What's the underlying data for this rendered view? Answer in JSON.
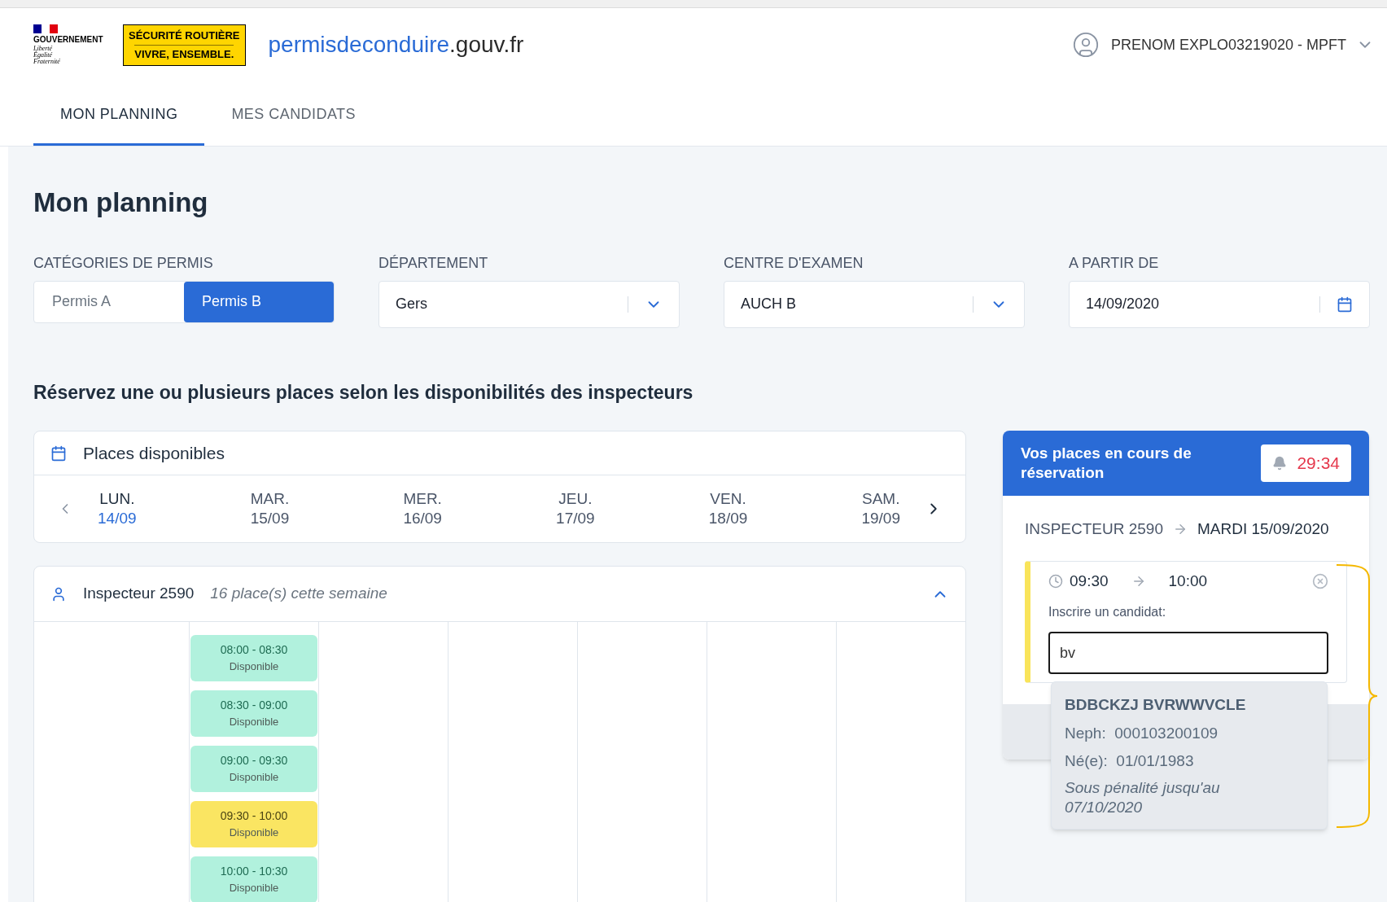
{
  "header": {
    "logo": {
      "name": "GOUVERNEMENT",
      "motto": [
        "Liberté",
        "Égalité",
        "Fraternité"
      ]
    },
    "badge": [
      "SÉCURITÉ ROUTIÈRE",
      "VIVRE, ENSEMBLE."
    ],
    "site": {
      "main": "permisdeconduire",
      "suffix": ".gouv.fr"
    },
    "user": "PRENOM EXPLO03219020 - MPFT"
  },
  "tabs": [
    {
      "label": "MON PLANNING",
      "selected": true
    },
    {
      "label": "MES CANDIDATS",
      "selected": false
    }
  ],
  "page_title": "Mon planning",
  "filters": {
    "categories": {
      "label": "CATÉGORIES DE PERMIS",
      "options": [
        {
          "label": "Permis A",
          "selected": false
        },
        {
          "label": "Permis B",
          "selected": true
        }
      ]
    },
    "departement": {
      "label": "DÉPARTEMENT",
      "value": "Gers"
    },
    "centre": {
      "label": "CENTRE D'EXAMEN",
      "value": "AUCH B"
    },
    "date": {
      "label": "A PARTIR DE",
      "value": "14/09/2020"
    }
  },
  "section_title": "Réservez une ou plusieurs places selon les disponibilités des inspecteurs",
  "places": {
    "title": "Places disponibles",
    "days": [
      {
        "day": "LUN.",
        "date": "14/09",
        "selected": true
      },
      {
        "day": "MAR.",
        "date": "15/09",
        "selected": false
      },
      {
        "day": "MER.",
        "date": "16/09",
        "selected": false
      },
      {
        "day": "JEU.",
        "date": "17/09",
        "selected": false
      },
      {
        "day": "VEN.",
        "date": "18/09",
        "selected": false
      },
      {
        "day": "SAM.",
        "date": "19/09",
        "selected": false
      }
    ]
  },
  "inspector": {
    "name": "Inspecteur 2590",
    "count": "16 place(s) cette semaine",
    "expanded": true,
    "slots": [
      {
        "time": "08:00 - 08:30",
        "status": "Disponible",
        "selected": false
      },
      {
        "time": "08:30 - 09:00",
        "status": "Disponible",
        "selected": false
      },
      {
        "time": "09:00 - 09:30",
        "status": "Disponible",
        "selected": false
      },
      {
        "time": "09:30 - 10:00",
        "status": "Disponible",
        "selected": true
      },
      {
        "time": "10:00 - 10:30",
        "status": "Disponible",
        "selected": false
      }
    ]
  },
  "reservation": {
    "title": "Vos places en cours de réservation",
    "timer": "29:34",
    "inspector": "INSPECTEUR 2590",
    "date": "MARDI 15/09/2020",
    "slot": {
      "start": "09:30",
      "end": "10:00",
      "label": "Inscrire un candidat:",
      "value": "bv"
    },
    "suggestion": {
      "name": "BDBCKZJ BVRWWVCLE",
      "neph_label": "Neph:",
      "neph": "000103200109",
      "born_label": "Né(e):",
      "born": "01/01/1983",
      "penalty": "Sous pénalité jusqu'au 07/10/2020"
    }
  }
}
